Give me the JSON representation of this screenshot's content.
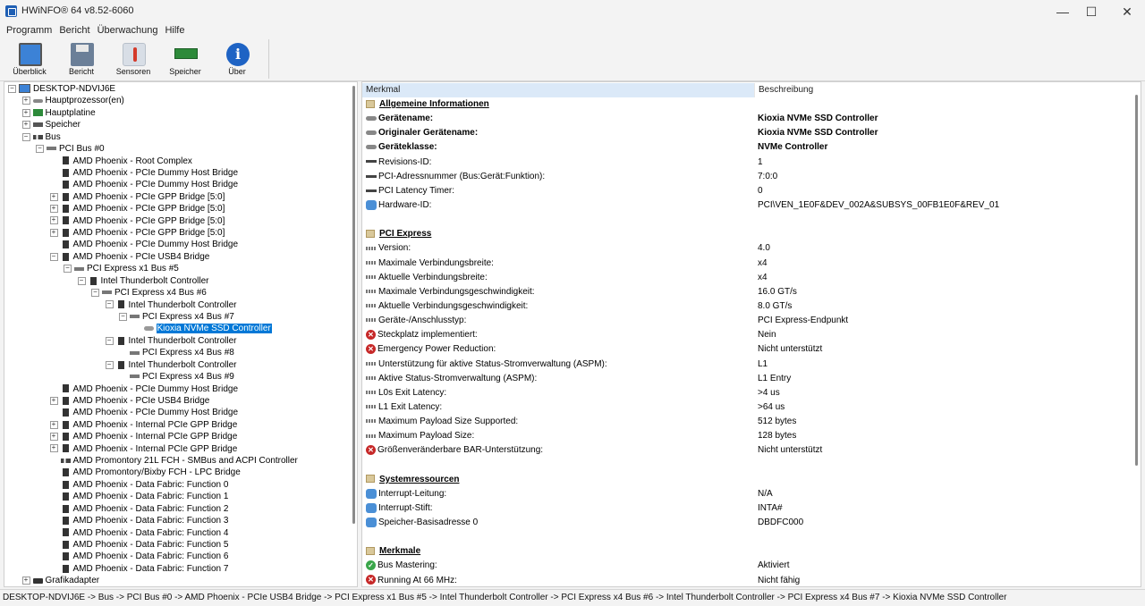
{
  "window": {
    "title": "HWiNFO® 64 v8.52-6060",
    "minimize_glyph": "—",
    "maximize_glyph": "☐",
    "close_glyph": "✕"
  },
  "menu": [
    "Programm",
    "Bericht",
    "Überwachung",
    "Hilfe"
  ],
  "toolbar": [
    {
      "label": "Überblick",
      "icon": "monitor-icon"
    },
    {
      "label": "Bericht",
      "icon": "floppy-icon"
    },
    {
      "label": "Sensoren",
      "icon": "thermometer-icon"
    },
    {
      "label": "Speicher",
      "icon": "memory-icon"
    },
    {
      "label": "Über",
      "icon": "info-icon",
      "glyph": "i"
    }
  ],
  "tree": [
    {
      "label": "DESKTOP-NDVIJ6E",
      "depth": 0,
      "exp": "−",
      "icon": "pc"
    },
    {
      "label": "Hauptprozessor(en)",
      "depth": 1,
      "exp": "+",
      "icon": "cpu"
    },
    {
      "label": "Hauptplatine",
      "depth": 1,
      "exp": "+",
      "icon": "mb"
    },
    {
      "label": "Speicher",
      "depth": 1,
      "exp": "+",
      "icon": "mem"
    },
    {
      "label": "Bus",
      "depth": 1,
      "exp": "−",
      "icon": "bus"
    },
    {
      "label": "PCI Bus #0",
      "depth": 2,
      "exp": "−",
      "icon": "pcie"
    },
    {
      "label": "AMD Phoenix - Root Complex",
      "depth": 3,
      "exp": "",
      "icon": "chip"
    },
    {
      "label": "AMD Phoenix - PCIe Dummy Host Bridge",
      "depth": 3,
      "exp": "",
      "icon": "chip"
    },
    {
      "label": "AMD Phoenix - PCIe Dummy Host Bridge",
      "depth": 3,
      "exp": "",
      "icon": "chip"
    },
    {
      "label": "AMD Phoenix - PCIe GPP Bridge [5:0]",
      "depth": 3,
      "exp": "+",
      "icon": "chip"
    },
    {
      "label": "AMD Phoenix - PCIe GPP Bridge [5:0]",
      "depth": 3,
      "exp": "+",
      "icon": "chip"
    },
    {
      "label": "AMD Phoenix - PCIe GPP Bridge [5:0]",
      "depth": 3,
      "exp": "+",
      "icon": "chip"
    },
    {
      "label": "AMD Phoenix - PCIe GPP Bridge [5:0]",
      "depth": 3,
      "exp": "+",
      "icon": "chip"
    },
    {
      "label": "AMD Phoenix - PCIe Dummy Host Bridge",
      "depth": 3,
      "exp": "",
      "icon": "chip"
    },
    {
      "label": "AMD Phoenix - PCIe USB4 Bridge",
      "depth": 3,
      "exp": "−",
      "icon": "chip"
    },
    {
      "label": "PCI Express x1 Bus #5",
      "depth": 4,
      "exp": "−",
      "icon": "pcie"
    },
    {
      "label": "Intel Thunderbolt Controller",
      "depth": 5,
      "exp": "−",
      "icon": "chip"
    },
    {
      "label": "PCI Express x4 Bus #6",
      "depth": 6,
      "exp": "−",
      "icon": "pcie"
    },
    {
      "label": "Intel Thunderbolt Controller",
      "depth": 7,
      "exp": "−",
      "icon": "chip"
    },
    {
      "label": "PCI Express x4 Bus #7",
      "depth": 8,
      "exp": "−",
      "icon": "pcie"
    },
    {
      "label": "Kioxia NVMe SSD Controller",
      "depth": 9,
      "exp": "",
      "icon": "disk",
      "selected": true
    },
    {
      "label": "Intel Thunderbolt Controller",
      "depth": 7,
      "exp": "−",
      "icon": "chip"
    },
    {
      "label": "PCI Express x4 Bus #8",
      "depth": 8,
      "exp": "",
      "icon": "pcie"
    },
    {
      "label": "Intel Thunderbolt Controller",
      "depth": 7,
      "exp": "−",
      "icon": "chip"
    },
    {
      "label": "PCI Express x4 Bus #9",
      "depth": 8,
      "exp": "",
      "icon": "pcie"
    },
    {
      "label": "AMD Phoenix - PCIe Dummy Host Bridge",
      "depth": 3,
      "exp": "",
      "icon": "chip"
    },
    {
      "label": "AMD Phoenix - PCIe USB4 Bridge",
      "depth": 3,
      "exp": "+",
      "icon": "chip"
    },
    {
      "label": "AMD Phoenix - PCIe Dummy Host Bridge",
      "depth": 3,
      "exp": "",
      "icon": "chip"
    },
    {
      "label": "AMD Phoenix - Internal PCIe GPP Bridge",
      "depth": 3,
      "exp": "+",
      "icon": "chip"
    },
    {
      "label": "AMD Phoenix - Internal PCIe GPP Bridge",
      "depth": 3,
      "exp": "+",
      "icon": "chip"
    },
    {
      "label": "AMD Phoenix - Internal PCIe GPP Bridge",
      "depth": 3,
      "exp": "+",
      "icon": "chip"
    },
    {
      "label": "AMD Promontory 21L FCH - SMBus and ACPI Controller",
      "depth": 3,
      "exp": "",
      "icon": "bus"
    },
    {
      "label": "AMD Promontory/Bixby FCH - LPC Bridge",
      "depth": 3,
      "exp": "",
      "icon": "chip"
    },
    {
      "label": "AMD Phoenix - Data Fabric: Function 0",
      "depth": 3,
      "exp": "",
      "icon": "chip"
    },
    {
      "label": "AMD Phoenix - Data Fabric: Function 1",
      "depth": 3,
      "exp": "",
      "icon": "chip"
    },
    {
      "label": "AMD Phoenix - Data Fabric: Function 2",
      "depth": 3,
      "exp": "",
      "icon": "chip"
    },
    {
      "label": "AMD Phoenix - Data Fabric: Function 3",
      "depth": 3,
      "exp": "",
      "icon": "chip"
    },
    {
      "label": "AMD Phoenix - Data Fabric: Function 4",
      "depth": 3,
      "exp": "",
      "icon": "chip"
    },
    {
      "label": "AMD Phoenix - Data Fabric: Function 5",
      "depth": 3,
      "exp": "",
      "icon": "chip"
    },
    {
      "label": "AMD Phoenix - Data Fabric: Function 6",
      "depth": 3,
      "exp": "",
      "icon": "chip"
    },
    {
      "label": "AMD Phoenix - Data Fabric: Function 7",
      "depth": 3,
      "exp": "",
      "icon": "chip"
    },
    {
      "label": "Grafikadapter",
      "depth": 1,
      "exp": "+",
      "icon": "gpu"
    }
  ],
  "details": {
    "columns": {
      "key": "Merkmal",
      "value": "Beschreibung"
    },
    "rows": [
      {
        "type": "section",
        "key": "Allgemeine Informationen",
        "value": ""
      },
      {
        "type": "bold",
        "icon": "dev",
        "key": "Gerätename:",
        "value": "Kioxia NVMe SSD Controller"
      },
      {
        "type": "bold",
        "icon": "dev",
        "key": "Originaler Gerätename:",
        "value": "Kioxia NVMe SSD Controller"
      },
      {
        "type": "bold",
        "icon": "dev",
        "key": "Geräteklasse:",
        "value": "NVMe Controller"
      },
      {
        "type": "normal",
        "icon": "pci",
        "key": "Revisions-ID:",
        "value": "1"
      },
      {
        "type": "normal",
        "icon": "pci",
        "key": "PCI-Adressnummer (Bus:Gerät:Funktion):",
        "value": "7:0:0"
      },
      {
        "type": "normal",
        "icon": "pci",
        "key": "PCI Latency Timer:",
        "value": "0"
      },
      {
        "type": "normal",
        "icon": "res",
        "key": "Hardware-ID:",
        "value": "PCI\\VEN_1E0F&DEV_002A&SUBSYS_00FB1E0F&REV_01"
      },
      {
        "type": "blank",
        "key": "",
        "value": ""
      },
      {
        "type": "section",
        "key": "PCI Express",
        "value": ""
      },
      {
        "type": "normal",
        "icon": "pcie",
        "key": "Version:",
        "value": "4.0"
      },
      {
        "type": "normal",
        "icon": "pcie",
        "key": "Maximale Verbindungsbreite:",
        "value": "x4"
      },
      {
        "type": "normal",
        "icon": "pcie",
        "key": "Aktuelle Verbindungsbreite:",
        "value": "x4"
      },
      {
        "type": "normal",
        "icon": "pcie",
        "key": "Maximale Verbindungsgeschwindigkeit:",
        "value": "16.0 GT/s"
      },
      {
        "type": "normal",
        "icon": "pcie",
        "key": "Aktuelle Verbindungsgeschwindigkeit:",
        "value": "8.0 GT/s"
      },
      {
        "type": "normal",
        "icon": "pcie",
        "key": "Geräte-/Anschlusstyp:",
        "value": "PCI Express-Endpunkt"
      },
      {
        "type": "normal",
        "icon": "err",
        "key": "Steckplatz implementiert:",
        "value": "Nein"
      },
      {
        "type": "normal",
        "icon": "err",
        "key": "Emergency Power Reduction:",
        "value": "Nicht unterstützt"
      },
      {
        "type": "normal",
        "icon": "pcie",
        "key": "Unterstützung für aktive Status-Stromverwaltung (ASPM):",
        "value": "L1"
      },
      {
        "type": "normal",
        "icon": "pcie",
        "key": "Aktive Status-Stromverwaltung (ASPM):",
        "value": "L1 Entry"
      },
      {
        "type": "normal",
        "icon": "pcie",
        "key": "L0s Exit Latency:",
        "value": ">4 us"
      },
      {
        "type": "normal",
        "icon": "pcie",
        "key": "L1 Exit Latency:",
        "value": ">64 us"
      },
      {
        "type": "normal",
        "icon": "pcie",
        "key": "Maximum Payload Size Supported:",
        "value": "512 bytes"
      },
      {
        "type": "normal",
        "icon": "pcie",
        "key": "Maximum Payload Size:",
        "value": "128 bytes"
      },
      {
        "type": "normal",
        "icon": "err",
        "key": "Größenveränderbare BAR-Unterstützung:",
        "value": "Nicht unterstützt"
      },
      {
        "type": "blank",
        "key": "",
        "value": ""
      },
      {
        "type": "section",
        "key": "Systemressourcen",
        "value": ""
      },
      {
        "type": "normal",
        "icon": "res",
        "key": "Interrupt-Leitung:",
        "value": "N/A"
      },
      {
        "type": "normal",
        "icon": "res",
        "key": "Interrupt-Stift:",
        "value": "INTA#"
      },
      {
        "type": "normal",
        "icon": "res",
        "key": "Speicher-Basisadresse 0",
        "value": "DBDFC000"
      },
      {
        "type": "blank",
        "key": "",
        "value": ""
      },
      {
        "type": "section",
        "key": "Merkmale",
        "value": ""
      },
      {
        "type": "normal",
        "icon": "ok",
        "key": "Bus Mastering:",
        "value": "Aktiviert"
      },
      {
        "type": "normal",
        "icon": "err",
        "key": "Running At 66 MHz:",
        "value": "Nicht fähig"
      }
    ]
  },
  "status": "DESKTOP-NDVIJ6E -> Bus -> PCI Bus #0 -> AMD Phoenix - PCIe USB4 Bridge -> PCI Express x1 Bus #5 -> Intel Thunderbolt Controller -> PCI Express x4 Bus #6 -> Intel Thunderbolt Controller -> PCI Express x4 Bus #7 -> Kioxia NVMe SSD Controller"
}
